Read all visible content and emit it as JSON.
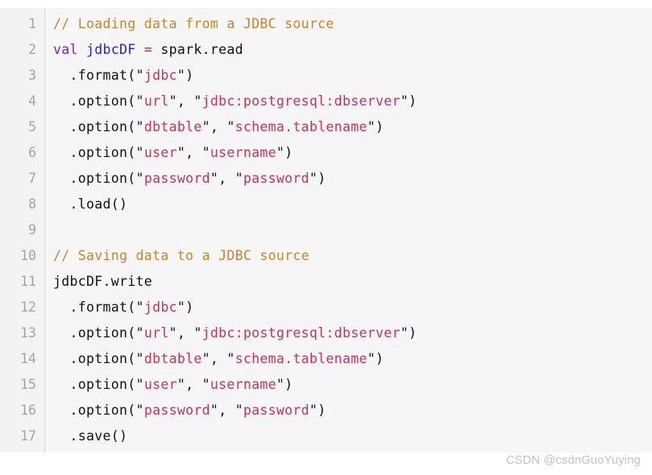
{
  "editor": {
    "language": "scala",
    "background_color": "#f6f6f6",
    "gutter_color": "#f3f3f3",
    "gutter_divider_color": "#d8d8d8",
    "line_number_color": "#a3a3a3",
    "first_line_number": 1,
    "total_lines": 17
  },
  "colors": {
    "comment": "#c9842a",
    "keyword": "#7a26a8",
    "variable": "#1f1fe0",
    "operator": "#d12020",
    "string": "#c2345a",
    "plain": "#111111"
  },
  "lines": [
    {
      "number": "1",
      "text": "// Loading data from a JDBC source",
      "tokens": [
        {
          "t": "// Loading data from a JDBC source",
          "c": "tok-comment"
        }
      ]
    },
    {
      "number": "2",
      "text": "val jdbcDF = spark.read",
      "tokens": [
        {
          "t": "val",
          "c": "tok-keyword"
        },
        {
          "t": " ",
          "c": "tok-plain"
        },
        {
          "t": "jdbcDF",
          "c": "tok-varname"
        },
        {
          "t": " ",
          "c": "tok-plain"
        },
        {
          "t": "=",
          "c": "tok-operator"
        },
        {
          "t": " spark.read",
          "c": "tok-plain"
        }
      ]
    },
    {
      "number": "3",
      "text": "  .format(\"jdbc\")",
      "tokens": [
        {
          "t": "  .format(",
          "c": "tok-plain"
        },
        {
          "t": "\"",
          "c": "tok-punct"
        },
        {
          "t": "jdbc",
          "c": "tok-string"
        },
        {
          "t": "\"",
          "c": "tok-punct"
        },
        {
          "t": ")",
          "c": "tok-plain"
        }
      ]
    },
    {
      "number": "4",
      "text": "  .option(\"url\", \"jdbc:postgresql:dbserver\")",
      "tokens": [
        {
          "t": "  .option(",
          "c": "tok-plain"
        },
        {
          "t": "\"",
          "c": "tok-punct"
        },
        {
          "t": "url",
          "c": "tok-string"
        },
        {
          "t": "\"",
          "c": "tok-punct"
        },
        {
          "t": ", ",
          "c": "tok-plain"
        },
        {
          "t": "\"",
          "c": "tok-punct"
        },
        {
          "t": "jdbc:postgresql:dbserver",
          "c": "tok-string"
        },
        {
          "t": "\"",
          "c": "tok-punct"
        },
        {
          "t": ")",
          "c": "tok-plain"
        }
      ]
    },
    {
      "number": "5",
      "text": "  .option(\"dbtable\", \"schema.tablename\")",
      "tokens": [
        {
          "t": "  .option(",
          "c": "tok-plain"
        },
        {
          "t": "\"",
          "c": "tok-punct"
        },
        {
          "t": "dbtable",
          "c": "tok-string"
        },
        {
          "t": "\"",
          "c": "tok-punct"
        },
        {
          "t": ", ",
          "c": "tok-plain"
        },
        {
          "t": "\"",
          "c": "tok-punct"
        },
        {
          "t": "schema.tablename",
          "c": "tok-string"
        },
        {
          "t": "\"",
          "c": "tok-punct"
        },
        {
          "t": ")",
          "c": "tok-plain"
        }
      ]
    },
    {
      "number": "6",
      "text": "  .option(\"user\", \"username\")",
      "tokens": [
        {
          "t": "  .option(",
          "c": "tok-plain"
        },
        {
          "t": "\"",
          "c": "tok-punct"
        },
        {
          "t": "user",
          "c": "tok-string"
        },
        {
          "t": "\"",
          "c": "tok-punct"
        },
        {
          "t": ", ",
          "c": "tok-plain"
        },
        {
          "t": "\"",
          "c": "tok-punct"
        },
        {
          "t": "username",
          "c": "tok-string"
        },
        {
          "t": "\"",
          "c": "tok-punct"
        },
        {
          "t": ")",
          "c": "tok-plain"
        }
      ]
    },
    {
      "number": "7",
      "text": "  .option(\"password\", \"password\")",
      "tokens": [
        {
          "t": "  .option(",
          "c": "tok-plain"
        },
        {
          "t": "\"",
          "c": "tok-punct"
        },
        {
          "t": "password",
          "c": "tok-string"
        },
        {
          "t": "\"",
          "c": "tok-punct"
        },
        {
          "t": ", ",
          "c": "tok-plain"
        },
        {
          "t": "\"",
          "c": "tok-punct"
        },
        {
          "t": "password",
          "c": "tok-string"
        },
        {
          "t": "\"",
          "c": "tok-punct"
        },
        {
          "t": ")",
          "c": "tok-plain"
        }
      ]
    },
    {
      "number": "8",
      "text": "  .load()",
      "tokens": [
        {
          "t": "  .load()",
          "c": "tok-plain"
        }
      ]
    },
    {
      "number": "9",
      "text": "",
      "tokens": []
    },
    {
      "number": "10",
      "text": "// Saving data to a JDBC source",
      "tokens": [
        {
          "t": "// Saving data to a JDBC source",
          "c": "tok-comment"
        }
      ]
    },
    {
      "number": "11",
      "text": "jdbcDF.write",
      "tokens": [
        {
          "t": "jdbcDF.write",
          "c": "tok-plain"
        }
      ]
    },
    {
      "number": "12",
      "text": "  .format(\"jdbc\")",
      "tokens": [
        {
          "t": "  .format(",
          "c": "tok-plain"
        },
        {
          "t": "\"",
          "c": "tok-punct"
        },
        {
          "t": "jdbc",
          "c": "tok-string"
        },
        {
          "t": "\"",
          "c": "tok-punct"
        },
        {
          "t": ")",
          "c": "tok-plain"
        }
      ]
    },
    {
      "number": "13",
      "text": "  .option(\"url\", \"jdbc:postgresql:dbserver\")",
      "tokens": [
        {
          "t": "  .option(",
          "c": "tok-plain"
        },
        {
          "t": "\"",
          "c": "tok-punct"
        },
        {
          "t": "url",
          "c": "tok-string"
        },
        {
          "t": "\"",
          "c": "tok-punct"
        },
        {
          "t": ", ",
          "c": "tok-plain"
        },
        {
          "t": "\"",
          "c": "tok-punct"
        },
        {
          "t": "jdbc:postgresql:dbserver",
          "c": "tok-string"
        },
        {
          "t": "\"",
          "c": "tok-punct"
        },
        {
          "t": ")",
          "c": "tok-plain"
        }
      ]
    },
    {
      "number": "14",
      "text": "  .option(\"dbtable\", \"schema.tablename\")",
      "tokens": [
        {
          "t": "  .option(",
          "c": "tok-plain"
        },
        {
          "t": "\"",
          "c": "tok-punct"
        },
        {
          "t": "dbtable",
          "c": "tok-string"
        },
        {
          "t": "\"",
          "c": "tok-punct"
        },
        {
          "t": ", ",
          "c": "tok-plain"
        },
        {
          "t": "\"",
          "c": "tok-punct"
        },
        {
          "t": "schema.tablename",
          "c": "tok-string"
        },
        {
          "t": "\"",
          "c": "tok-punct"
        },
        {
          "t": ")",
          "c": "tok-plain"
        }
      ]
    },
    {
      "number": "15",
      "text": "  .option(\"user\", \"username\")",
      "tokens": [
        {
          "t": "  .option(",
          "c": "tok-plain"
        },
        {
          "t": "\"",
          "c": "tok-punct"
        },
        {
          "t": "user",
          "c": "tok-string"
        },
        {
          "t": "\"",
          "c": "tok-punct"
        },
        {
          "t": ", ",
          "c": "tok-plain"
        },
        {
          "t": "\"",
          "c": "tok-punct"
        },
        {
          "t": "username",
          "c": "tok-string"
        },
        {
          "t": "\"",
          "c": "tok-punct"
        },
        {
          "t": ")",
          "c": "tok-plain"
        }
      ]
    },
    {
      "number": "16",
      "text": "  .option(\"password\", \"password\")",
      "tokens": [
        {
          "t": "  .option(",
          "c": "tok-plain"
        },
        {
          "t": "\"",
          "c": "tok-punct"
        },
        {
          "t": "password",
          "c": "tok-string"
        },
        {
          "t": "\"",
          "c": "tok-punct"
        },
        {
          "t": ", ",
          "c": "tok-plain"
        },
        {
          "t": "\"",
          "c": "tok-punct"
        },
        {
          "t": "password",
          "c": "tok-string"
        },
        {
          "t": "\"",
          "c": "tok-punct"
        },
        {
          "t": ")",
          "c": "tok-plain"
        }
      ]
    },
    {
      "number": "17",
      "text": "  .save()",
      "tokens": [
        {
          "t": "  .save()",
          "c": "tok-plain"
        }
      ]
    }
  ],
  "watermark": {
    "text": "CSDN @csdnGuoYuying",
    "color": "#c2c2c2"
  }
}
